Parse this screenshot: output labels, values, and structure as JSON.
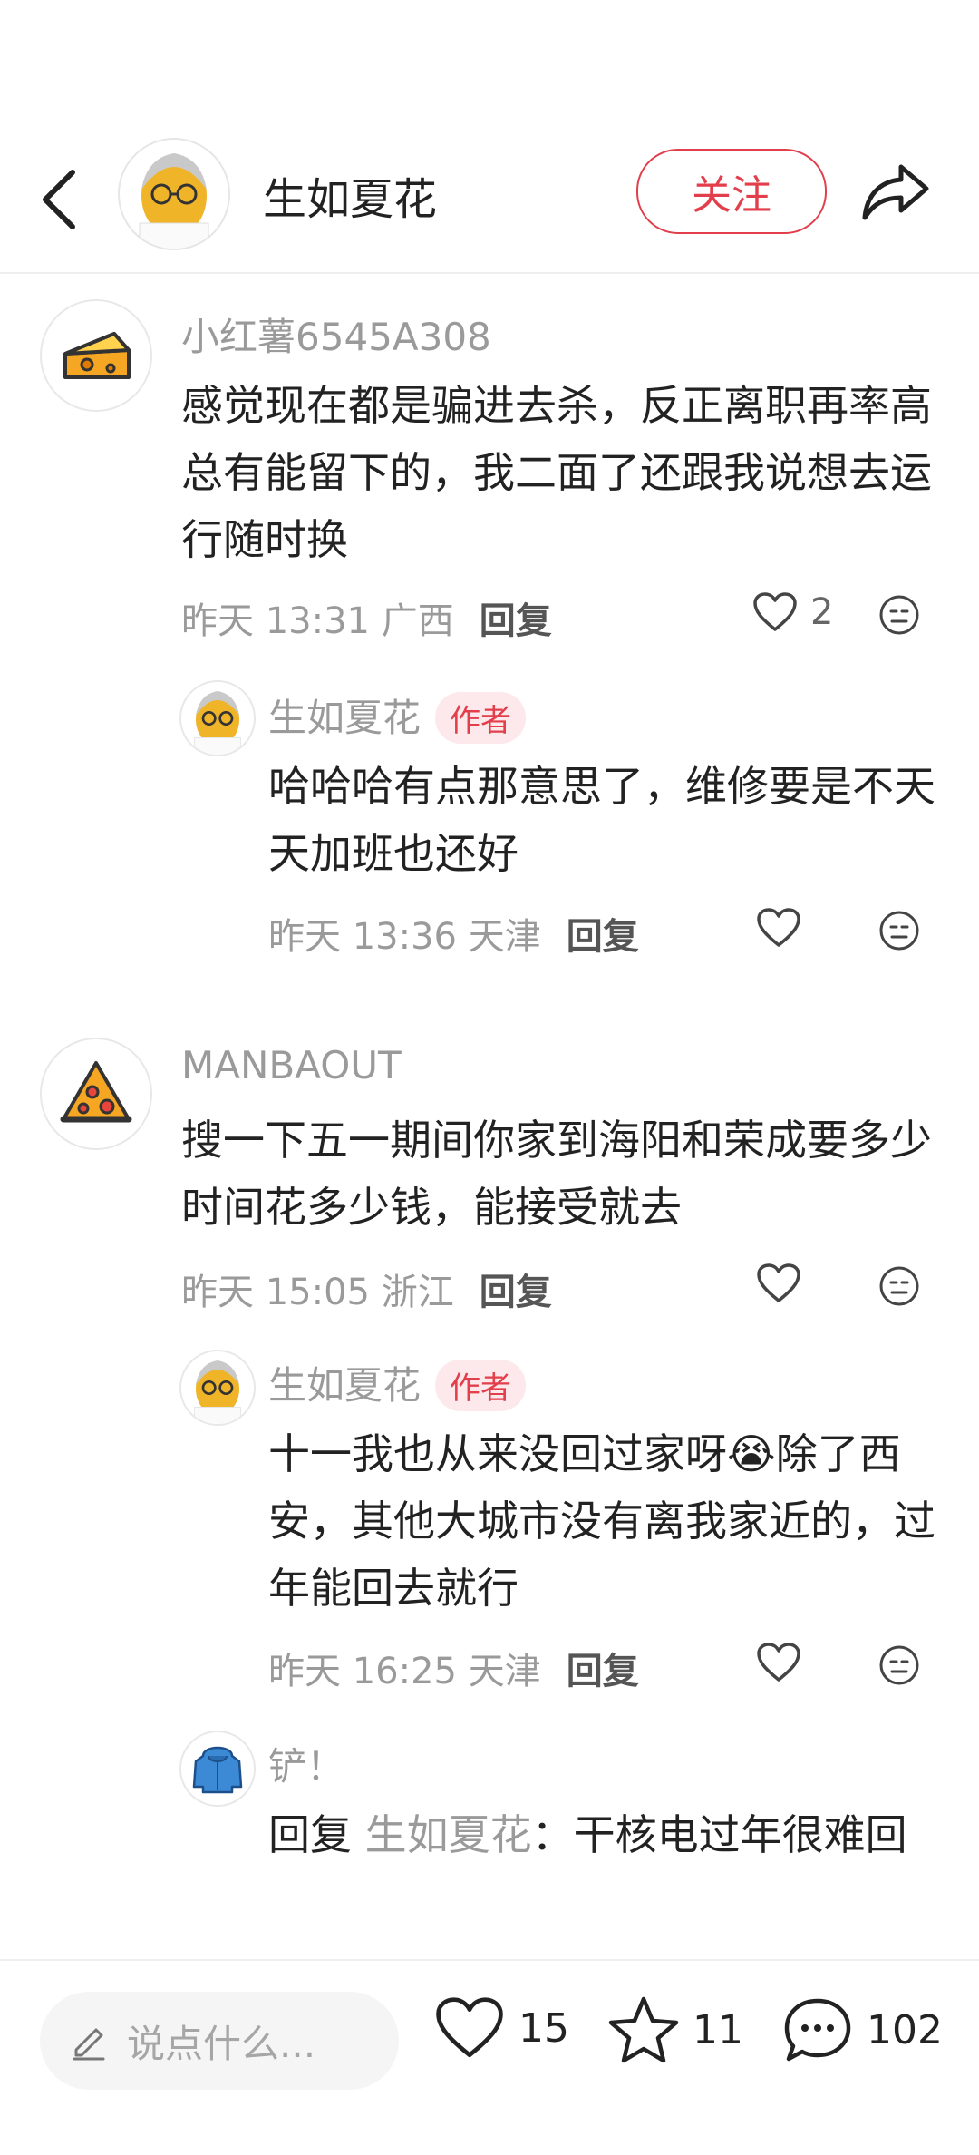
{
  "header": {
    "author_name": "生如夏花",
    "follow_label": "关注",
    "back_icon": "chevron-left-icon",
    "share_icon": "share-arrow-icon"
  },
  "comments": [
    {
      "user": "小红薯6545A308",
      "avatar": "cheese-avatar",
      "text": "感觉现在都是骗进去杀，反正离职再率高总有能留下的，我二面了还跟我说想去运行随时换",
      "time": "昨天 13:31 广西",
      "reply_label": "回复",
      "likes": "2",
      "replies": [
        {
          "user": "生如夏花",
          "badge": "作者",
          "text": "哈哈哈有点那意思了，维修要是不天天加班也还好",
          "time": "昨天 13:36 天津",
          "reply_label": "回复"
        }
      ]
    },
    {
      "user": "MANBAOUT",
      "avatar": "pizza-avatar",
      "text": "搜一下五一期间你家到海阳和荣成要多少时间花多少钱，能接受就去",
      "time": "昨天 15:05 浙江",
      "reply_label": "回复",
      "replies": [
        {
          "user": "生如夏花",
          "badge": "作者",
          "text": "十一我也从来没回过家呀😭除了西安，其他大城市没有离我家近的，过年能回去就行",
          "time": "昨天 16:25 天津",
          "reply_label": "回复"
        },
        {
          "user": "铲！",
          "reply_prefix": "回复",
          "reply_to": "生如夏花",
          "colon": "：",
          "text": "干核电过年很难回"
        }
      ]
    }
  ],
  "bottom_bar": {
    "input_placeholder": "说点什么...",
    "likes": "15",
    "stars": "11",
    "comments": "102"
  },
  "colors": {
    "accent": "#e23e4b",
    "muted": "#9a9a9a"
  }
}
